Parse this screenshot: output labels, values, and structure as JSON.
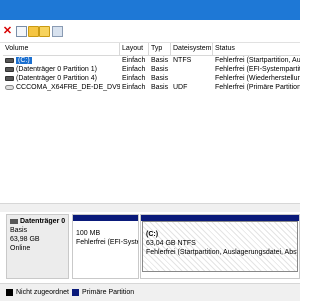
{
  "colors": {
    "titlebar": "#1e78d6",
    "primary_partition": "#0a1a7a",
    "unallocated": "#000000",
    "selection": "#1a6fd0"
  },
  "toolbar": {
    "icons": [
      "delete-icon",
      "properties-icon",
      "open-icon",
      "explore-icon",
      "help-icon"
    ]
  },
  "volume_list": {
    "columns": [
      "Volume",
      "Layout",
      "Typ",
      "Dateisystem",
      "Status"
    ],
    "rows": [
      {
        "volume": "(C:)",
        "layout": "Einfach",
        "typ": "Basis",
        "dateisystem": "NTFS",
        "status": "Fehlerfrei (Startpartition, Ausla",
        "icon": "drive-icon",
        "selected": true
      },
      {
        "volume": "(Datenträger 0 Partition 1)",
        "layout": "Einfach",
        "typ": "Basis",
        "dateisystem": "",
        "status": "Fehlerfrei (EFI-Systempartition)",
        "icon": "drive-icon"
      },
      {
        "volume": "(Datenträger 0 Partition 4)",
        "layout": "Einfach",
        "typ": "Basis",
        "dateisystem": "",
        "status": "Fehlerfrei (Wiederherstellung",
        "icon": "drive-icon"
      },
      {
        "volume": "CCCOMA_X64FRE_DE-DE_DV9 (D:)",
        "layout": "Einfach",
        "typ": "Basis",
        "dateisystem": "UDF",
        "status": "Fehlerfrei (Primäre Partition)",
        "icon": "cd-drive-icon"
      }
    ]
  },
  "disk": {
    "name": "Datenträger 0",
    "type": "Basis",
    "size": "63,98 GB",
    "state": "Online",
    "partitions": [
      {
        "size": "100 MB",
        "status": "Fehlerfrei (EFI-Syste"
      },
      {
        "label": "(C:)",
        "size": "63,04 GB NTFS",
        "status": "Fehlerfrei (Startpartition, Auslagerungsdatei, Absturz"
      }
    ]
  },
  "legend": [
    {
      "label": "Nicht zugeordnet",
      "color": "#000000"
    },
    {
      "label": "Primäre Partition",
      "color": "#0a1a7a"
    }
  ]
}
